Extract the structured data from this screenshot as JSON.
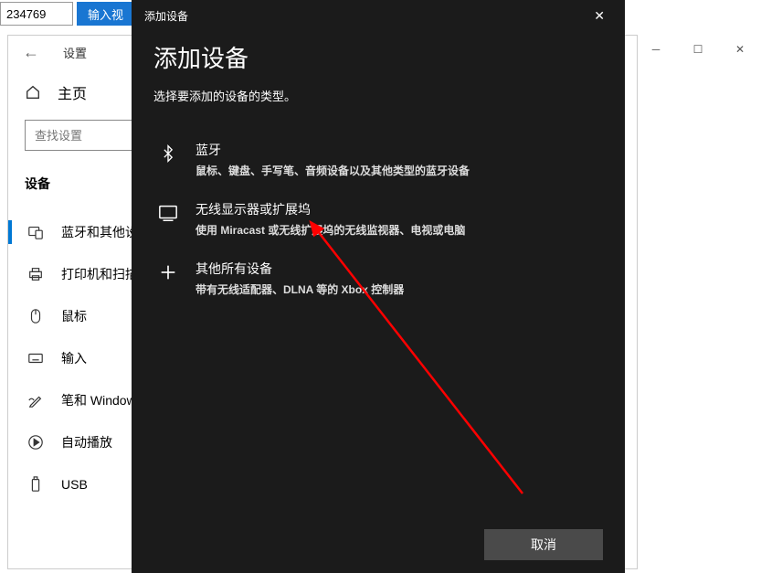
{
  "topbar": {
    "url_value": "234769",
    "btn_label": "输入视"
  },
  "settings": {
    "title": "设置",
    "home_label": "主页",
    "search_placeholder": "查找设置",
    "section": "设备",
    "items": [
      {
        "label": "蓝牙和其他设"
      },
      {
        "label": "打印机和扫描"
      },
      {
        "label": "鼠标"
      },
      {
        "label": "输入"
      },
      {
        "label": "笔和 Windows"
      },
      {
        "label": "自动播放"
      },
      {
        "label": "USB"
      }
    ]
  },
  "modal": {
    "titlebar": "添加设备",
    "heading": "添加设备",
    "subheading": "选择要添加的设备的类型。",
    "options": [
      {
        "title": "蓝牙",
        "desc": "鼠标、键盘、手写笔、音频设备以及其他类型的蓝牙设备"
      },
      {
        "title": "无线显示器或扩展坞",
        "desc": "使用 Miracast 或无线扩展坞的无线监视器、电视或电脑"
      },
      {
        "title": "其他所有设备",
        "desc": "带有无线适配器、DLNA 等的 Xbox 控制器"
      }
    ],
    "cancel": "取消"
  }
}
